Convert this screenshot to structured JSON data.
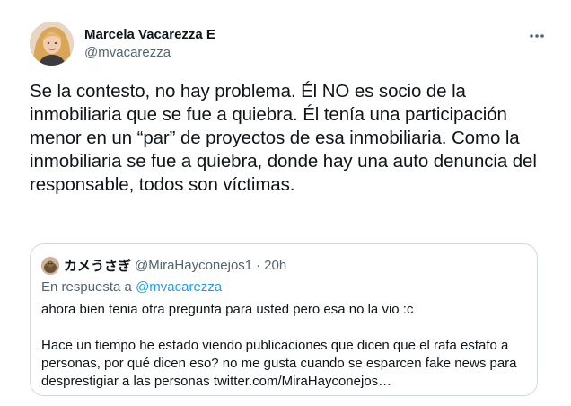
{
  "author": {
    "display_name": "Marcela Vacarezza E",
    "handle": "@mvacarezza"
  },
  "tweet": {
    "text": "Se la contesto, no hay problema. Él NO es socio de la inmobiliaria que se fue a quiebra. Él tenía una participación menor en un “par” de proyectos de esa inmobiliaria. Como la inmobiliaria se fue a quiebra, donde hay una auto denuncia del responsable, todos son víctimas."
  },
  "quoted": {
    "display_name": "カメうさぎ",
    "handle": "@MiraHayconejos1",
    "separator": "·",
    "time": "20h",
    "reply_prefix": "En respuesta a",
    "reply_to": "@mvacarezza",
    "paragraph1": "ahora bien tenia otra pregunta para usted pero esa no la vio :c",
    "paragraph2": "Hace un tiempo he estado viendo publicaciones que dicen que el rafa estafo a personas, por qué dicen eso? no me gusta cuando se esparcen fake news para desprestigiar a las personas  twitter.com/MiraHayconejos…"
  },
  "icons": {
    "more": "more-options-icon"
  },
  "colors": {
    "text_primary": "#0f1419",
    "text_secondary": "#536471",
    "link": "#1d9bf0",
    "border": "#cfd9de"
  }
}
